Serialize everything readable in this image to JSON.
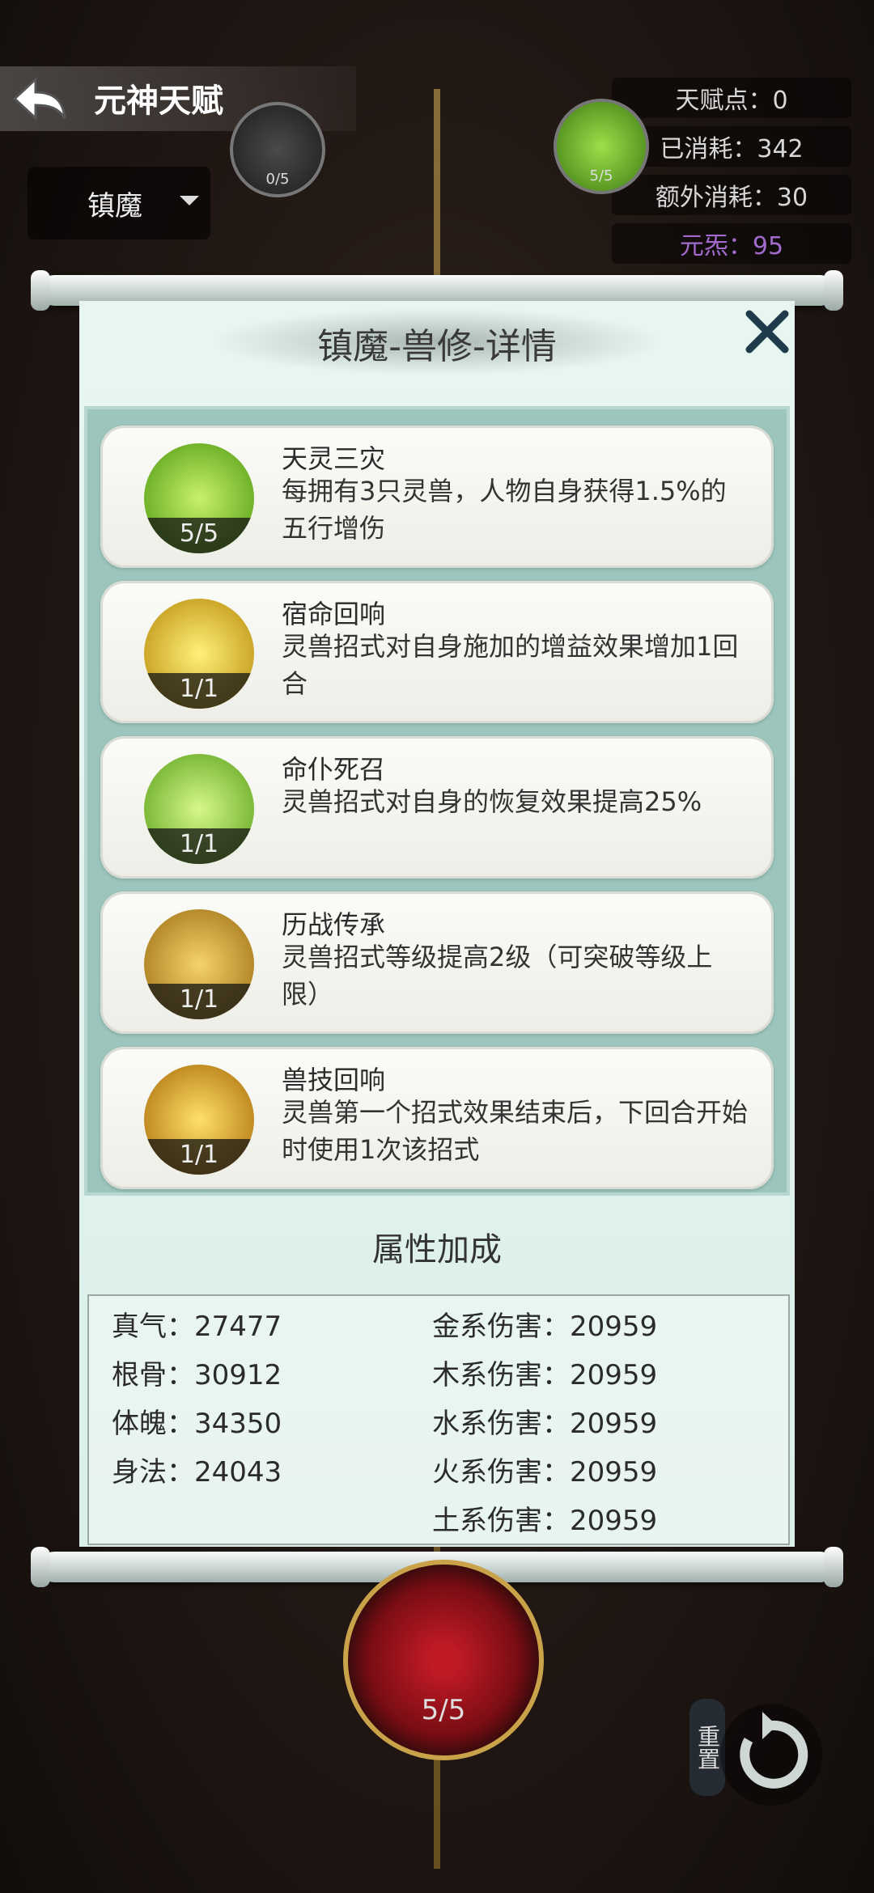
{
  "header": {
    "title": "元神天赋",
    "dropdown_value": "镇魔"
  },
  "stats": [
    {
      "label": "天赋点：0"
    },
    {
      "label": "已消耗：342"
    },
    {
      "label": "额外消耗：30"
    },
    {
      "label": "元炁：95"
    }
  ],
  "bg_nodes": {
    "left_count": "0/5",
    "right_count": "5/5",
    "bottom_count": "5/5"
  },
  "panel": {
    "title": "镇魔-兽修-详情",
    "skills": [
      {
        "name": "天灵三灾",
        "desc": "每拥有3只灵兽，人物自身获得1.5%的五行增伤",
        "level": "5/5",
        "color": "#7ccc2a"
      },
      {
        "name": "宿命回响",
        "desc": "灵兽招式对自身施加的增益效果增加1回合",
        "level": "1/1",
        "color": "#e6c01a"
      },
      {
        "name": "命仆死召",
        "desc": "灵兽招式对自身的恢复效果提高25%",
        "level": "1/1",
        "color": "#8acc26"
      },
      {
        "name": "历战传承",
        "desc": "灵兽招式等级提高2级（可突破等级上限）",
        "level": "1/1",
        "color": "#d8a826"
      },
      {
        "name": "兽技回响",
        "desc": "灵兽第一个招式效果结束后，下回合开始时使用1次该招式",
        "level": "1/1",
        "color": "#e2a818"
      }
    ],
    "attr_title": "属性加成",
    "attrs_left": [
      "真气：27477",
      "根骨：30912",
      "体魄：34350",
      "身法：24043"
    ],
    "attrs_right": [
      "金系伤害：20959",
      "木系伤害：20959",
      "水系伤害：20959",
      "火系伤害：20959",
      "土系伤害：20959"
    ]
  },
  "reset_label": "重置"
}
